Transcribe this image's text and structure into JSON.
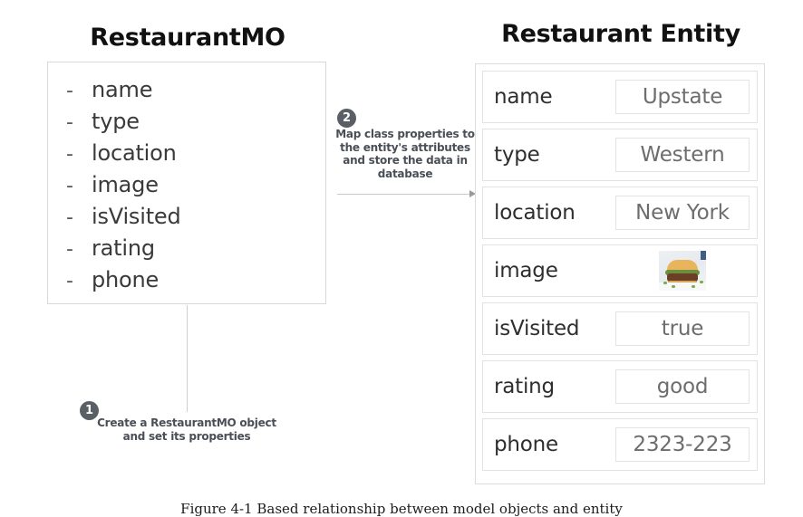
{
  "left_panel": {
    "title": "RestaurantMO",
    "properties": [
      {
        "bullet": "-",
        "name": "name"
      },
      {
        "bullet": "-",
        "name": "type"
      },
      {
        "bullet": "-",
        "name": "location"
      },
      {
        "bullet": "-",
        "name": "image"
      },
      {
        "bullet": "-",
        "name": "isVisited"
      },
      {
        "bullet": "-",
        "name": "rating"
      },
      {
        "bullet": "-",
        "name": "phone"
      }
    ]
  },
  "right_panel": {
    "title": "Restaurant Entity",
    "rows": [
      {
        "key": "name",
        "value": "Upstate"
      },
      {
        "key": "type",
        "value": "Western"
      },
      {
        "key": "location",
        "value": "New York"
      },
      {
        "key": "image",
        "value": ""
      },
      {
        "key": "isVisited",
        "value": "true"
      },
      {
        "key": "rating",
        "value": "good"
      },
      {
        "key": "phone",
        "value": "2323-223"
      }
    ]
  },
  "steps": [
    {
      "number": "1",
      "text": "Create a RestaurantMO object and set its properties"
    },
    {
      "number": "2",
      "text": "Map class properties to the entity's attributes and store the data in database"
    }
  ],
  "caption": "Figure 4-1 Based relationship between model objects and entity",
  "icons": {
    "image_thumbnail": "burger-photo-icon",
    "arrow": "right-arrow-icon"
  },
  "colors": {
    "badge_background": "#5a5f66",
    "badge_text": "#ffffff",
    "box_border": "#d8d8d8",
    "row_border": "#e2e2e2",
    "value_text": "#6d6d6d",
    "key_text": "#2e2e2e",
    "connector": "#c9c9c9",
    "background": "#ffffff"
  }
}
